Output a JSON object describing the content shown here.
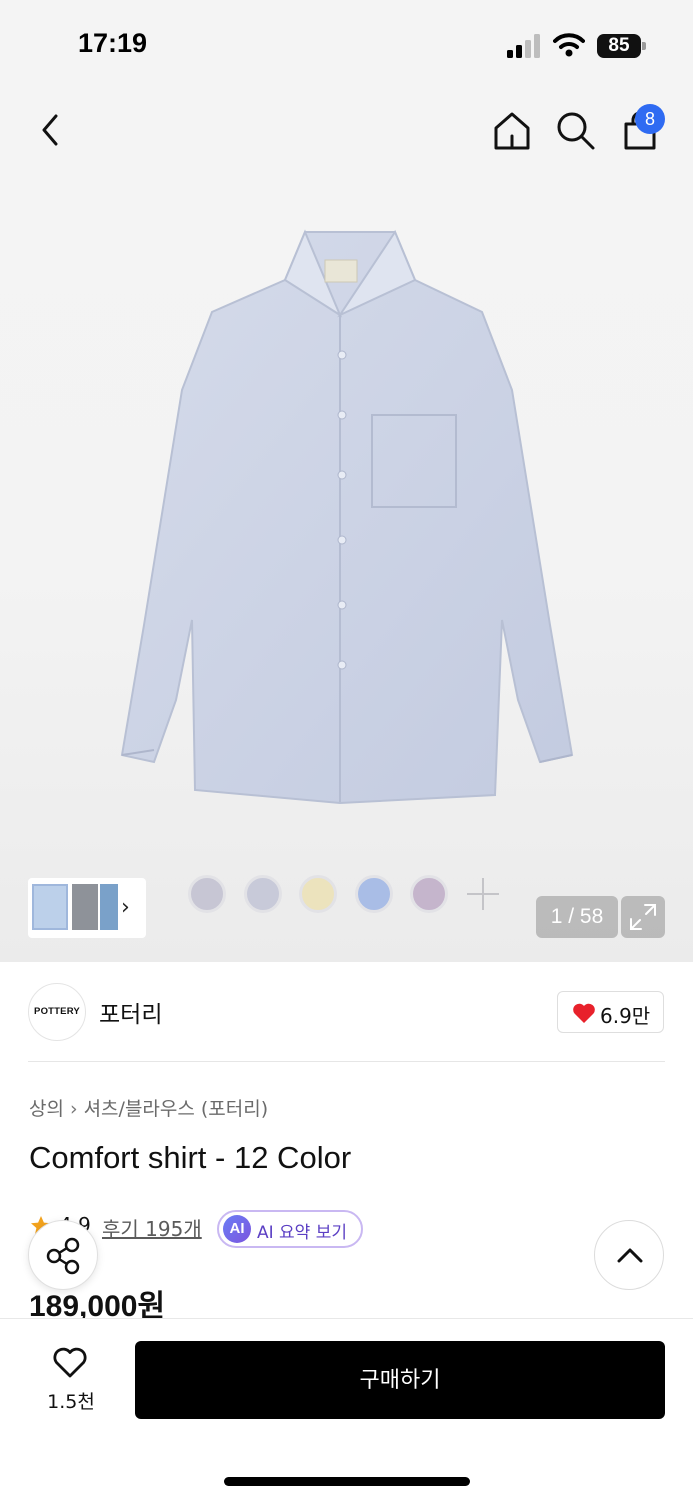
{
  "status_bar": {
    "time": "17:19",
    "battery": "85"
  },
  "nav": {
    "cart_badge": "8"
  },
  "gallery": {
    "swatch_colors": [
      "#c7c6d4",
      "#c8cad9",
      "#ece3bd",
      "#a9bde6",
      "#c5b5cc"
    ],
    "counter": "1 / 58"
  },
  "brand": {
    "logo_text": "POTTERY",
    "name": "포터리",
    "like_count": "6.9만"
  },
  "breadcrumb": {
    "category": "상의",
    "subcategory": "셔츠/블라우스 (포터리)"
  },
  "product": {
    "title": "Comfort shirt - 12 Color",
    "rating": "4.9",
    "reviews": "후기 195개",
    "ai_badge": "AI",
    "ai_label": "AI 요약 보기",
    "price": "189,000원"
  },
  "bottom_bar": {
    "wish_count": "1.5천",
    "buy_label": "구매하기"
  },
  "colors": {
    "accent_blue": "#2f6bf2",
    "ai_purple": "#5c40c4",
    "heart_red": "#e8212b"
  }
}
